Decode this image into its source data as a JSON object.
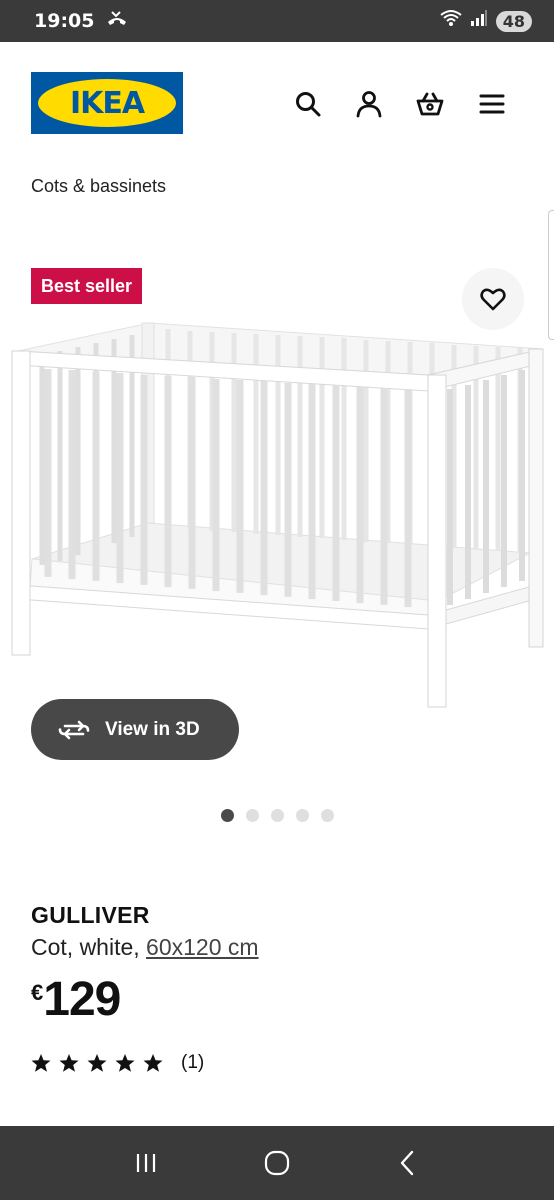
{
  "status_bar": {
    "time": "19:05",
    "battery": "48"
  },
  "header": {
    "logo_text": "IKEA"
  },
  "breadcrumb": "Cots & bassinets",
  "badge": "Best seller",
  "view_3d_label": "View in 3D",
  "carousel": {
    "count": 5,
    "active": 0
  },
  "product": {
    "name": "GULLIVER",
    "description_prefix": "Cot, white, ",
    "size": "60x120 cm",
    "currency": "€",
    "price": "129",
    "rating": 5,
    "review_count": "(1)"
  },
  "colors": {
    "ikea_blue": "#0058a3",
    "ikea_yellow": "#ffdb00",
    "badge_red": "#cc0f47"
  }
}
